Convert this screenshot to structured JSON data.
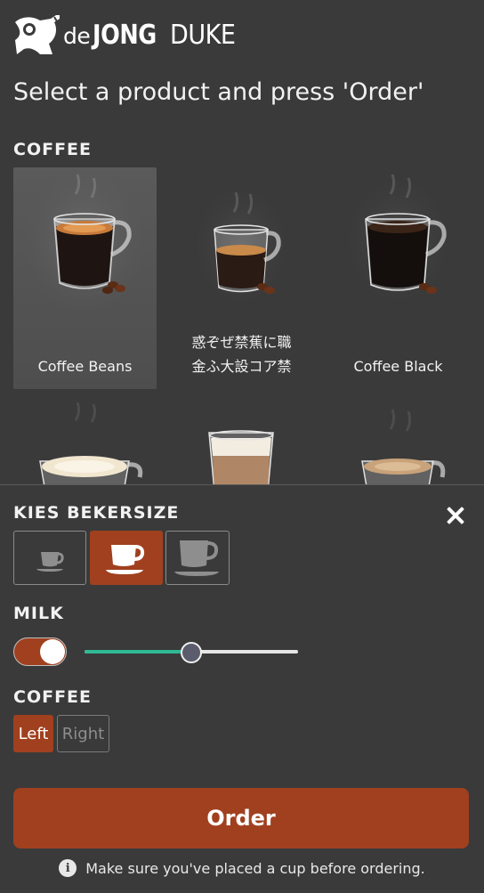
{
  "brand": {
    "logo_text_de": "de",
    "logo_text_jong": "JONG",
    "logo_text_duke": "DUKE"
  },
  "headline": "Select a product and press 'Order'",
  "coffee_section": {
    "title": "COFFEE",
    "products": [
      {
        "label": "Coffee Beans",
        "selected": true,
        "icon": "espresso-cup-icon"
      },
      {
        "label": "惑ぞぜ禁蕉に職金ふ大設コア禁",
        "selected": false,
        "icon": "small-glass-cup-icon"
      },
      {
        "label": "Coffee Black",
        "selected": false,
        "icon": "black-coffee-cup-icon"
      }
    ],
    "row2_icons": [
      "cappuccino-cup-icon",
      "latte-glass-icon",
      "cafe-creme-cup-icon"
    ]
  },
  "panel": {
    "cup_size_title": "KIES BEKERSIZE",
    "cup_sizes": [
      {
        "name": "small",
        "active": false
      },
      {
        "name": "medium",
        "active": true
      },
      {
        "name": "large",
        "active": false
      }
    ],
    "milk_title": "MILK",
    "milk_enabled": true,
    "milk_level": 0.5,
    "coffee_title": "COFFEE",
    "side_left": "Left",
    "side_right": "Right",
    "side_selected": "Left",
    "order_label": "Order",
    "hint": "Make sure you've placed a cup before ordering."
  },
  "colors": {
    "accent": "#a0401f",
    "background": "#3a3a3a",
    "slider_fill": "#2fb994"
  }
}
